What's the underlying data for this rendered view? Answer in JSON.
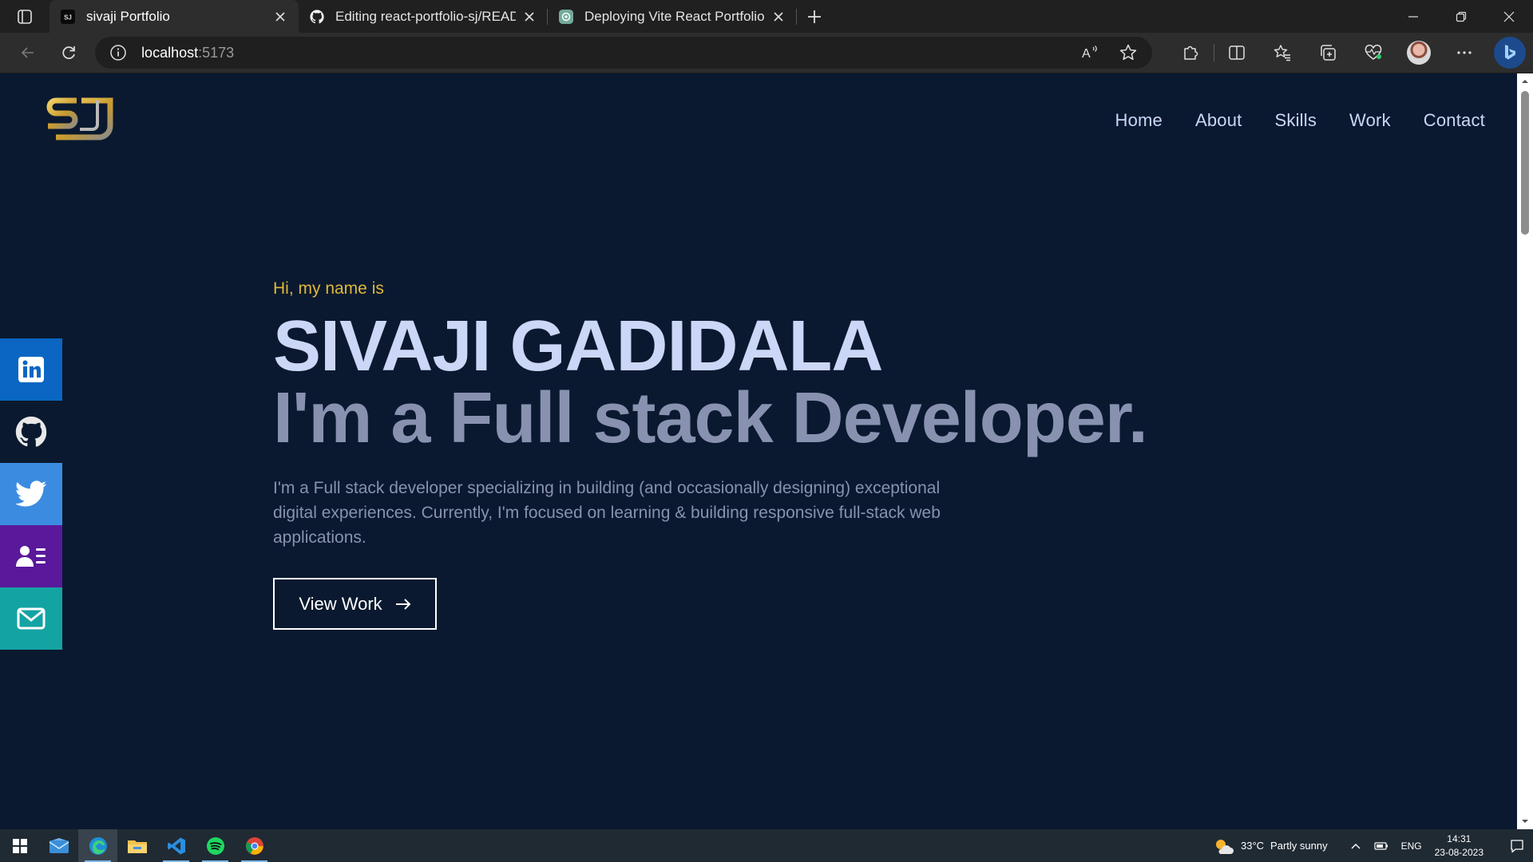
{
  "browser": {
    "tabs": [
      {
        "title": "sivaji Portfolio",
        "active": true,
        "favicon": "sj-logo-icon"
      },
      {
        "title": "Editing react-portfolio-sj/READM",
        "active": false,
        "favicon": "github-icon"
      },
      {
        "title": "Deploying Vite React Portfolio",
        "active": false,
        "favicon": "chatgpt-icon"
      }
    ],
    "url_host": "localhost",
    "url_port": ":5173"
  },
  "site": {
    "nav": [
      "Home",
      "About",
      "Skills",
      "Work",
      "Contact"
    ],
    "greeting": "Hi, my name is",
    "name": "SIVAJI GADIDALA",
    "tagline": "I'm a Full stack Developer.",
    "bio": "I'm a Full stack developer specializing in building (and occasionally designing) exceptional digital experiences. Currently, I'm focused on learning & building responsive full-stack web applications.",
    "cta_label": "View Work",
    "social": [
      {
        "name": "linkedin-icon",
        "color": "#0a66c2"
      },
      {
        "name": "github-icon",
        "color": "#2b2b2b"
      },
      {
        "name": "twitter-icon",
        "color": "#1da1f2"
      },
      {
        "name": "resume-icon",
        "color": "#5a189a"
      },
      {
        "name": "mail-icon",
        "color": "#14a3a3"
      }
    ],
    "colors": {
      "background": "#0a192f",
      "accent": "#e0b83a",
      "primary_text": "#ccd6f6",
      "secondary_text": "#8892b0"
    }
  },
  "taskbar": {
    "weather_temp": "33°C",
    "weather_text": "Partly sunny",
    "language": "ENG",
    "time": "14:31",
    "date": "23-08-2023"
  }
}
